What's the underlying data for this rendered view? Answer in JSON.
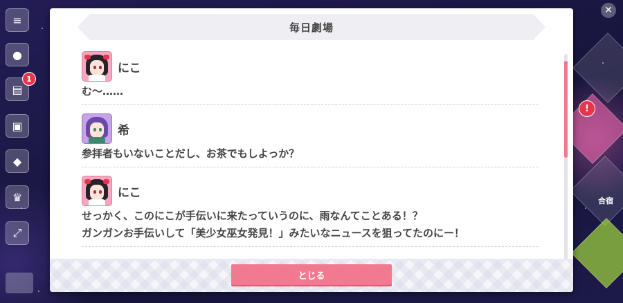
{
  "modal": {
    "title": "毎日劇場",
    "close_label": "とじる"
  },
  "dialogue": [
    {
      "speaker": "にこ",
      "avatar": "niko-avatar",
      "lines": [
        "む～……"
      ]
    },
    {
      "speaker": "希",
      "avatar": "nozomi-avatar",
      "lines": [
        "参拝者もいないことだし、お茶でもしよっか？"
      ]
    },
    {
      "speaker": "にこ",
      "avatar": "niko-avatar",
      "lines": [
        "せっかく、このにこが手伝いに来たっていうのに、雨なんてことある！？",
        "ガンガンお手伝いして「美少女巫女発見！」みたいなニュースを狙ってたのにー！"
      ]
    }
  ],
  "background": {
    "event_badge_count": "1",
    "right_badge": "!",
    "right_label": "合宿"
  },
  "colors": {
    "accent": "#f27a90",
    "title_bar": "#eeeef3",
    "text": "#444444"
  }
}
